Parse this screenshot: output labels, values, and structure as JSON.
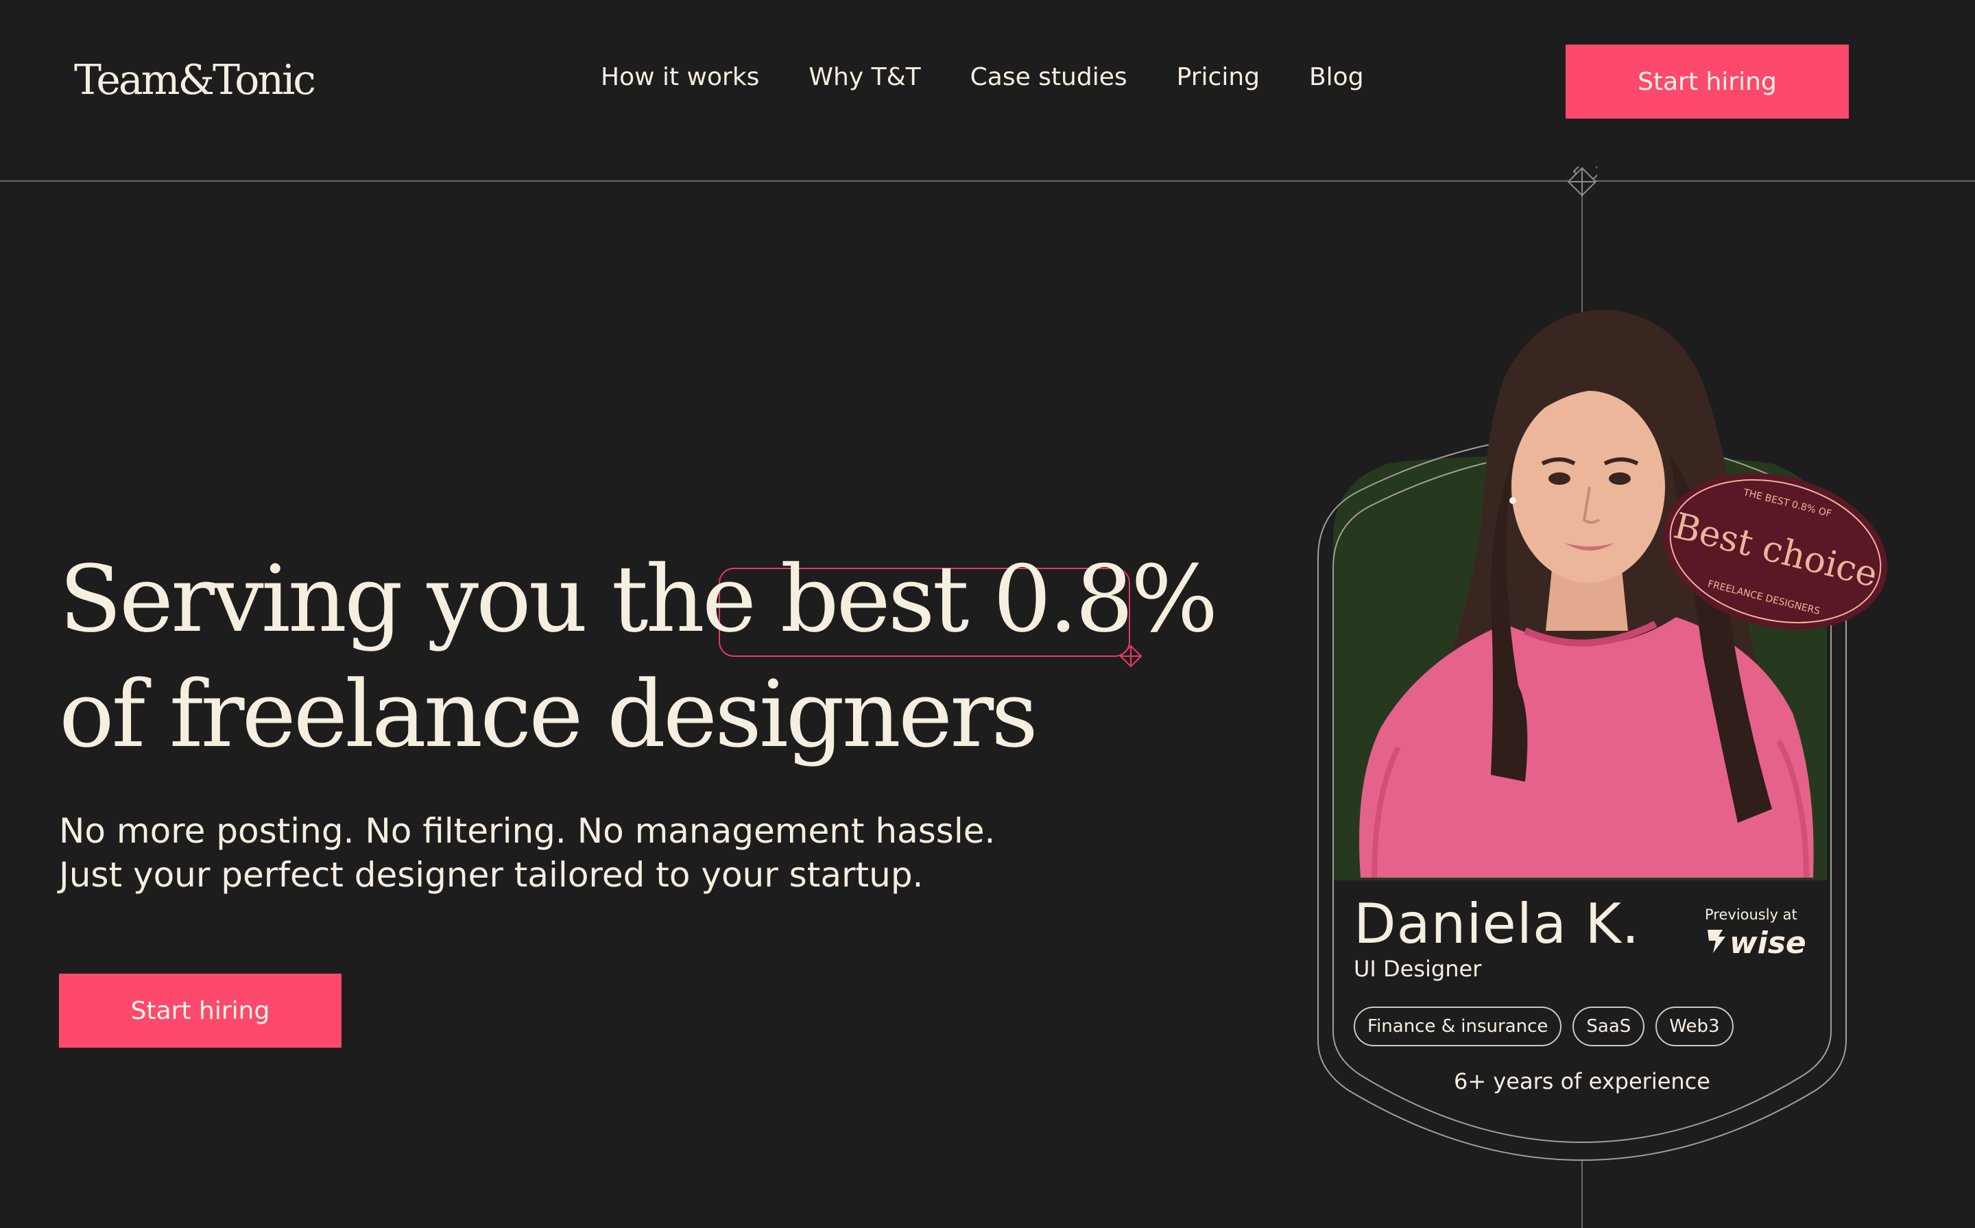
{
  "brand": {
    "logo_text": "Team&Tonic"
  },
  "nav": {
    "items": [
      {
        "label": "How it works"
      },
      {
        "label": "Why T&T"
      },
      {
        "label": "Case studies"
      },
      {
        "label": "Pricing"
      },
      {
        "label": "Blog"
      }
    ]
  },
  "header": {
    "cta_label": "Start hiring"
  },
  "hero": {
    "headline_part1": "Serving you the ",
    "headline_highlight": "best 0.8%",
    "headline_line2": "of freelance designers",
    "subcopy_line1": "No more posting. No filtering. No management hassle.",
    "subcopy_line2": "Just your perfect designer tailored to your startup.",
    "cta_label": "Start hiring"
  },
  "profile": {
    "name": "Daniela K.",
    "role": "UI Designer",
    "previously_label": "Previously at",
    "previous_company": "wise",
    "tags": [
      "Finance & insurance",
      "SaaS",
      "Web3"
    ],
    "experience": "6+ years of experience",
    "badge": {
      "top_text": "THE BEST 0.8% OF",
      "main_text": "Best choice",
      "bottom_text": "FREELANCE DESIGNERS"
    }
  },
  "colors": {
    "background": "#1e1d1e",
    "cream": "#f6efdf",
    "accent": "#fd4a6c",
    "highlight_border": "#e63a63",
    "card_green": "#26391f",
    "badge_maroon": "#5a1725",
    "badge_gold": "#e8b79a"
  }
}
